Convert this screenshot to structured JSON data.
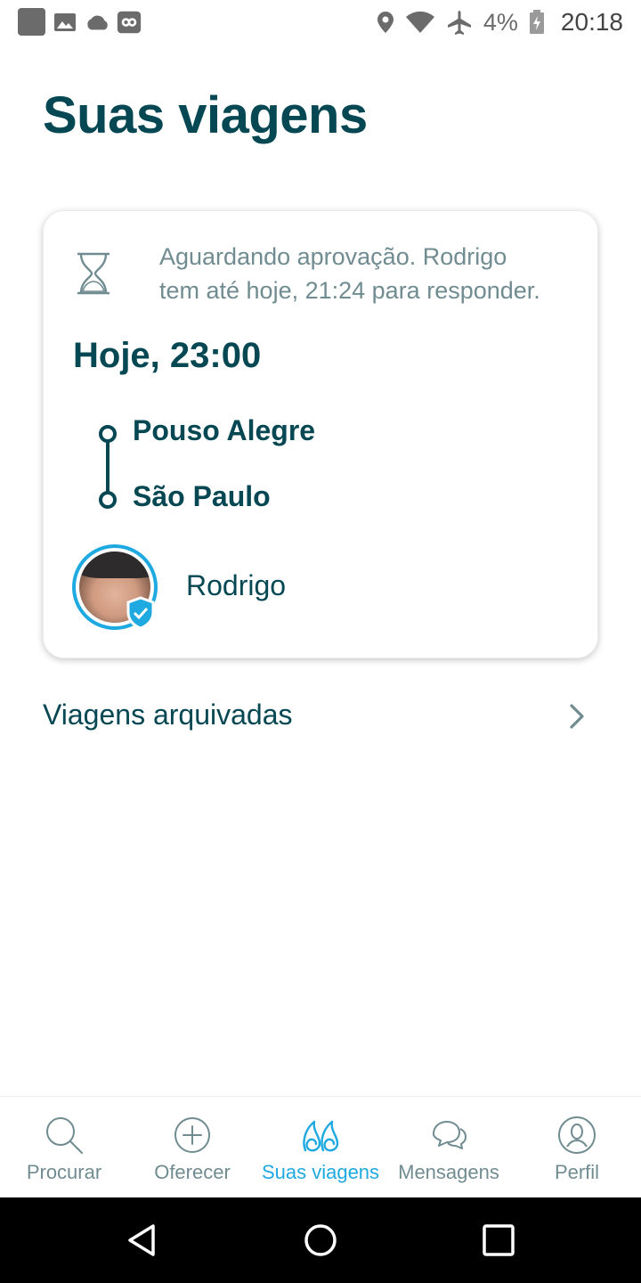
{
  "status_bar": {
    "battery_percent": "4%",
    "time": "20:18",
    "icons": [
      "app-icon",
      "image-icon",
      "cloud-icon",
      "infinity-icon",
      "location-icon",
      "wifi-icon",
      "airplane-icon",
      "battery-icon"
    ]
  },
  "page": {
    "title": "Suas viagens"
  },
  "trip_card": {
    "status_line1": "Aguardando aprovação. Rodrigo",
    "status_line2": "tem até hoje, 21:24 para responder.",
    "time": "Hoje, 23:00",
    "from": "Pouso Alegre",
    "to": "São Paulo",
    "driver_name": "Rodrigo"
  },
  "archived": {
    "label": "Viagens arquivadas"
  },
  "bottom_nav": {
    "items": [
      {
        "label": "Procurar",
        "icon": "search-icon",
        "active": false
      },
      {
        "label": "Oferecer",
        "icon": "plus-circle-icon",
        "active": false
      },
      {
        "label": "Suas viagens",
        "icon": "trips-icon",
        "active": true
      },
      {
        "label": "Mensagens",
        "icon": "chat-icon",
        "active": false
      },
      {
        "label": "Perfil",
        "icon": "profile-icon",
        "active": false
      }
    ]
  },
  "colors": {
    "primary_text": "#054752",
    "secondary_text": "#708c91",
    "accent": "#1ea9e1"
  }
}
